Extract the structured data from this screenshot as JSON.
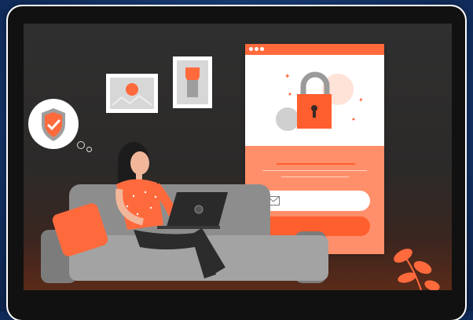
{
  "colors": {
    "accent": "#ff6a3d",
    "accent_dark": "#ff5e2e",
    "panel_lower": "#ff8f6a",
    "background": "#163a74",
    "screen": "#2f2f2f"
  },
  "icons": {
    "badge": "shield-check-icon",
    "lock": "padlock-icon",
    "email": "envelope-icon",
    "laptop_logo": "laptop-logo-icon"
  }
}
